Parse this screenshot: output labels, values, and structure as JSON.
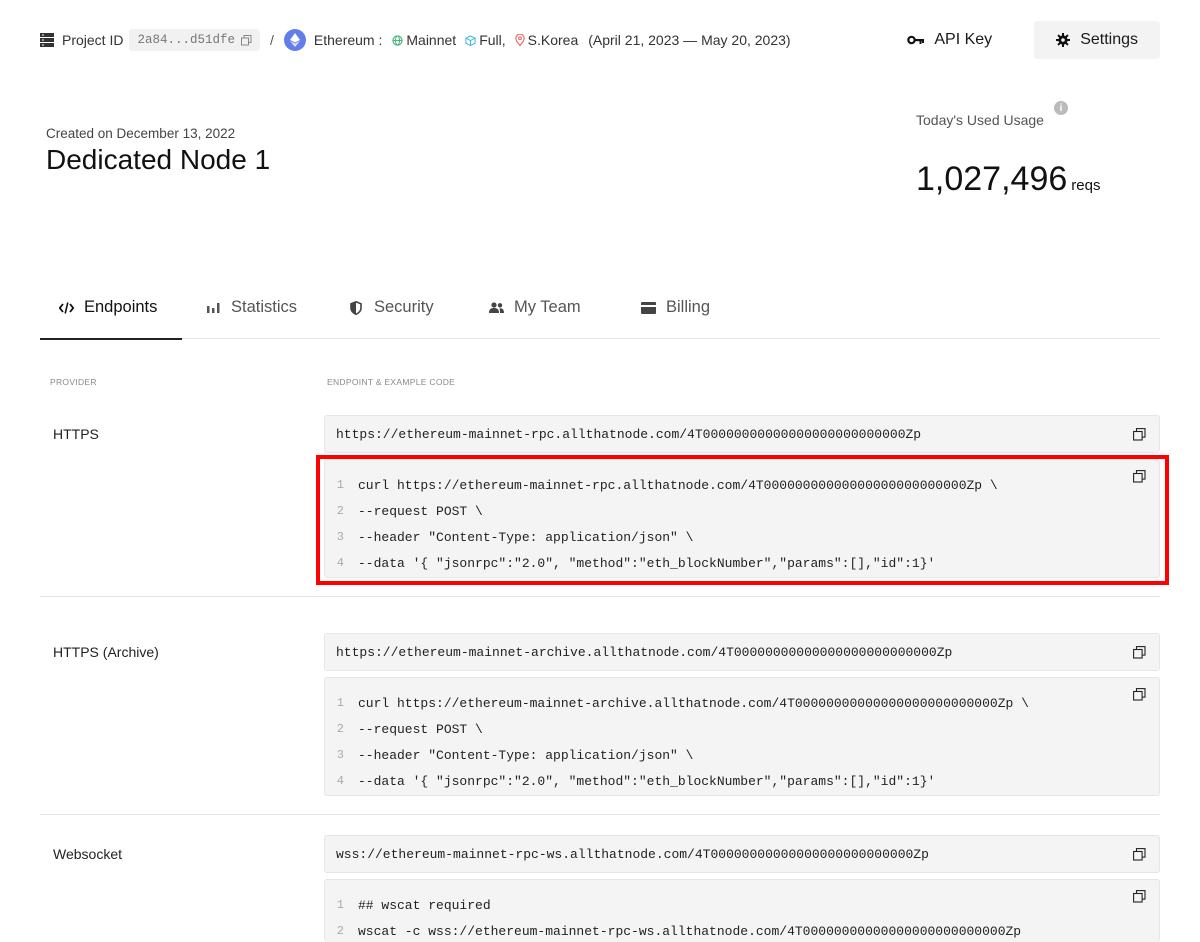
{
  "topbar": {
    "project_label": "Project ID",
    "project_id": "2a84...d51dfe",
    "separator": "/",
    "network": "Ethereum :",
    "mainnet": "Mainnet",
    "node_type": "Full,",
    "region": "S.Korea",
    "period": "(April 21, 2023 — May 20, 2023)",
    "api_key_label": "API Key",
    "settings_label": "Settings"
  },
  "header": {
    "created": "Created on December 13, 2022",
    "title": "Dedicated Node 1",
    "usage_label": "Today's Used Usage",
    "usage_value": "1,027,496",
    "usage_unit": "reqs"
  },
  "tabs": [
    {
      "label": "Endpoints"
    },
    {
      "label": "Statistics"
    },
    {
      "label": "Security"
    },
    {
      "label": "My Team"
    },
    {
      "label": "Billing"
    }
  ],
  "columns": {
    "provider": "PROVIDER",
    "endpoint": "ENDPOINT & EXAMPLE CODE"
  },
  "endpoints": [
    {
      "provider": "HTTPS",
      "url": "https://ethereum-mainnet-rpc.allthatnode.com/4T00000000000000000000000000Zp",
      "code": [
        {
          "n": "1",
          "text": "curl https://ethereum-mainnet-rpc.allthatnode.com/4T00000000000000000000000000Zp \\"
        },
        {
          "n": "2",
          "text": "--request POST \\"
        },
        {
          "n": "3",
          "text": "--header \"Content-Type: application/json\" \\"
        },
        {
          "n": "4",
          "text": "--data '{ \"jsonrpc\":\"2.0\", \"method\":\"eth_blockNumber\",\"params\":[],\"id\":1}'"
        }
      ]
    },
    {
      "provider": "HTTPS (Archive)",
      "url": "https://ethereum-mainnet-archive.allthatnode.com/4T00000000000000000000000000Zp",
      "code": [
        {
          "n": "1",
          "text": "curl https://ethereum-mainnet-archive.allthatnode.com/4T00000000000000000000000000Zp \\"
        },
        {
          "n": "2",
          "text": "--request POST \\"
        },
        {
          "n": "3",
          "text": "--header \"Content-Type: application/json\" \\"
        },
        {
          "n": "4",
          "text": "--data '{ \"jsonrpc\":\"2.0\", \"method\":\"eth_blockNumber\",\"params\":[],\"id\":1}'"
        }
      ]
    },
    {
      "provider": "Websocket",
      "url": "wss://ethereum-mainnet-rpc-ws.allthatnode.com/4T00000000000000000000000000Zp",
      "code": [
        {
          "n": "1",
          "text": "## wscat required"
        },
        {
          "n": "2",
          "text": "wscat -c wss://ethereum-mainnet-rpc-ws.allthatnode.com/4T00000000000000000000000000Zp"
        }
      ]
    }
  ],
  "colors": {
    "highlight": "#ff0000",
    "eth": "#627eea",
    "mainnet_icon": "#3cb371",
    "full_icon": "#38b6e6",
    "region_icon": "#e8615a"
  },
  "icons": [
    "database-icon",
    "copy-icon",
    "ethereum-icon",
    "globe-icon",
    "cube-icon",
    "location-pin-icon",
    "key-icon",
    "gear-icon",
    "info-icon",
    "code-icon",
    "bar-chart-icon",
    "shield-icon",
    "team-icon",
    "card-icon"
  ]
}
